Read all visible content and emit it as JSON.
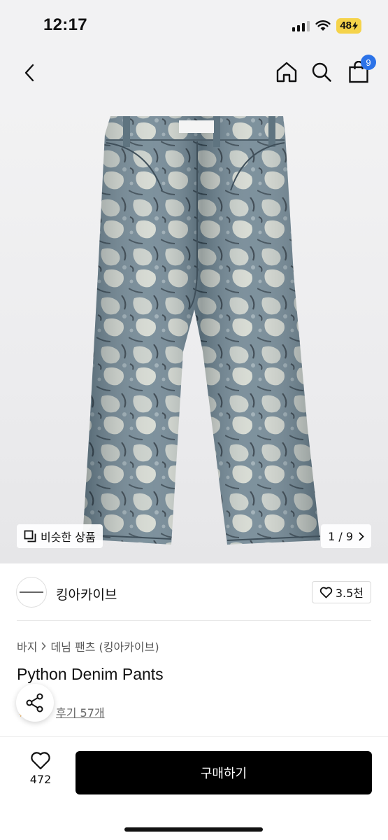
{
  "status_bar": {
    "time": "12:17",
    "battery": "48",
    "icons": [
      "signal-icon",
      "wifi-icon",
      "battery-icon"
    ]
  },
  "header": {
    "icons": [
      "back-icon",
      "home-icon",
      "search-icon",
      "shopping-bag-icon"
    ],
    "cart_count": "9"
  },
  "gallery": {
    "similar_label": "비슷한 상품",
    "counter": "1 / 9"
  },
  "shop": {
    "name": "킹아카이브",
    "likes": "3.5천"
  },
  "breadcrumb": {
    "category": "바지",
    "subcategory": "데님 팬츠 (킹아카이브)"
  },
  "product": {
    "title": "Python Denim Pants",
    "reviews": "후기 57개"
  },
  "bottom_bar": {
    "wish_count": "472",
    "buy_label": "구매하기"
  },
  "colors": {
    "accent_badge": "#2c73e8",
    "buy_button": "#000000",
    "battery": "#f5d34a"
  }
}
